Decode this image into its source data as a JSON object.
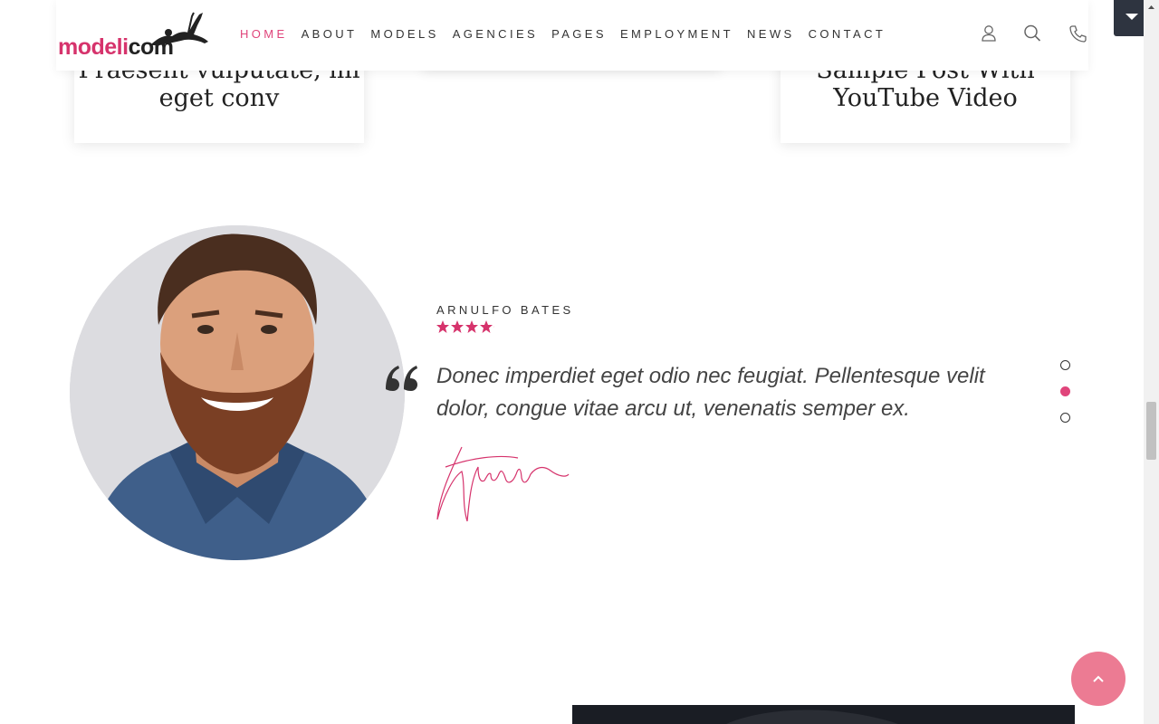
{
  "header": {
    "logo": {
      "text_pink": "modeli",
      "text_dark": "com"
    },
    "nav": [
      {
        "label": "HOME",
        "active": true
      },
      {
        "label": "ABOUT",
        "active": false
      },
      {
        "label": "MODELS",
        "active": false
      },
      {
        "label": "AGENCIES",
        "active": false
      },
      {
        "label": "PAGES",
        "active": false
      },
      {
        "label": "EMPLOYMENT",
        "active": false
      },
      {
        "label": "NEWS",
        "active": false
      },
      {
        "label": "CONTACT",
        "active": false
      }
    ],
    "icons": [
      "user-icon",
      "search-icon",
      "phone-icon"
    ]
  },
  "posts": {
    "left_title": "Praesent vulputate, mi eget conv",
    "right_title": "Sample Post With YouTube Video"
  },
  "testimonial": {
    "name": "ARNULFO BATES",
    "rating": 4,
    "rating_max": 5,
    "quote": "Donec imperdiet eget odio nec feugiat. Pellentesque velit dolor, congue vitae arcu ut, venenatis semper ex.",
    "slide_count": 3,
    "active_slide": 2
  },
  "colors": {
    "accent": "#e0457b",
    "back_to_top": "#ec7b93",
    "toggle_bg": "#2e3440"
  }
}
